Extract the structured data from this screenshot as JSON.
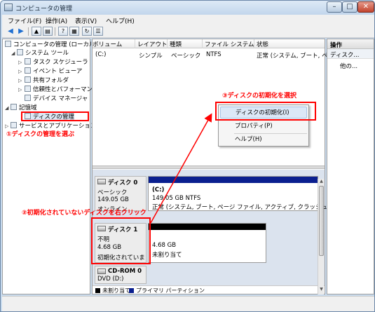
{
  "window": {
    "title": "コンピュータの管理"
  },
  "menu": [
    "ファイル(F)",
    "操作(A)",
    "表示(V)",
    "ヘルプ(H)"
  ],
  "tree": {
    "root": "コンピュータの管理 (ローカル)",
    "system_tools": "システム ツール",
    "task_scheduler": "タスク スケジューラ",
    "event_viewer": "イベント ビューア",
    "shared_folders": "共有フォルダ",
    "reliability": "信頼性とパフォーマンス",
    "device_manager": "デバイス マネージャ",
    "storage": "記憶域",
    "disk_management": "ディスクの管理",
    "services_apps": "サービスとアプリケーション"
  },
  "volume_list": {
    "headers": [
      "ボリューム",
      "レイアウト",
      "種類",
      "ファイル システム",
      "状態"
    ],
    "rows": [
      [
        "(C:)",
        "シンプル",
        "ベーシック",
        "NTFS",
        "正常 (システム, ブート, ペ"
      ]
    ]
  },
  "disks": [
    {
      "name": "ディスク 0",
      "type": "ベーシック",
      "size": "149.05 GB",
      "state": "オンライン",
      "vol_name": "(C:)",
      "vol_line1": "149.05 GB NTFS",
      "vol_line2": "正常 (システム, ブート, ページ ファイル, アクティブ, クラッシュ",
      "bar_color": "#0a1f8f"
    },
    {
      "name": "ディスク 1",
      "type": "不明",
      "size": "4.68 GB",
      "state": "初期化されていま",
      "vol_line1": "4.68 GB",
      "vol_line2": "未割り当て",
      "bar_color": "#000000"
    },
    {
      "name": "CD-ROM 0",
      "type": "DVD (D:)"
    }
  ],
  "legend": [
    {
      "label": "未割り当て",
      "color": "#000000"
    },
    {
      "label": "プライマリ パーティション",
      "color": "#0a1f8f"
    }
  ],
  "context_menu": {
    "items": [
      "ディスクの初期化(I)",
      "プロパティ(P)",
      "ヘルプ(H)"
    ]
  },
  "operations": {
    "title": "操作",
    "section": "ディスク...",
    "more": "他の..."
  },
  "annotations": {
    "step1": "①ディスクの管理を選ぶ",
    "step2": "②初期化されていないディスクを右クリック",
    "step3": "③ディスクの初期化を選択"
  },
  "colors": {
    "annotation": "#ff0000",
    "primary_partition": "#0a1f8f",
    "unallocated": "#000000"
  }
}
